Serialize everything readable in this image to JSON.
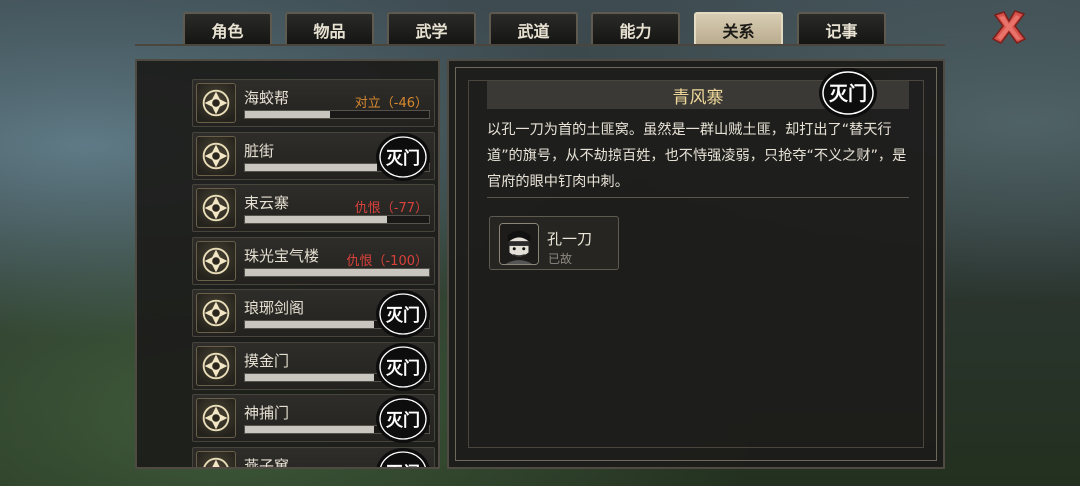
{
  "tabs": [
    {
      "label": "角色",
      "active": false
    },
    {
      "label": "物品",
      "active": false
    },
    {
      "label": "武学",
      "active": false
    },
    {
      "label": "武道",
      "active": false
    },
    {
      "label": "能力",
      "active": false
    },
    {
      "label": "关系",
      "active": true
    },
    {
      "label": "记事",
      "active": false
    }
  ],
  "close_icon": "close-x-icon",
  "stamp_text": "灭门",
  "factions": [
    {
      "name": "海蛟帮",
      "status": "对立（-46）",
      "status_color": "#d8892e",
      "relation": 0.46,
      "destroyed": false,
      "icon": "sea-dragon-emblem-icon"
    },
    {
      "name": "脏街",
      "status": "",
      "relation": 0.72,
      "destroyed": true,
      "icon": "beast-mask-emblem-icon"
    },
    {
      "name": "束云寨",
      "status": "仇恨（-77）",
      "status_color": "#d8413a",
      "relation": 0.77,
      "destroyed": false,
      "icon": "mountain-emblem-icon"
    },
    {
      "name": "珠光宝气楼",
      "status": "仇恨（-100）",
      "status_color": "#d8413a",
      "relation": 1.0,
      "destroyed": false,
      "icon": "treasure-emblem-icon"
    },
    {
      "name": "琅琊剑阁",
      "status": "",
      "relation": 0.7,
      "destroyed": true,
      "icon": "crown-emblem-icon"
    },
    {
      "name": "摸金门",
      "status": "",
      "relation": 0.7,
      "destroyed": true,
      "icon": "tomb-emblem-icon"
    },
    {
      "name": "神捕门",
      "status": "",
      "relation": 0.7,
      "destroyed": true,
      "icon": "eye-emblem-icon"
    },
    {
      "name": "燕子窠",
      "status": "",
      "relation": 0.7,
      "destroyed": true,
      "icon": "swallow-emblem-icon"
    }
  ],
  "detail": {
    "title": "青风寨",
    "destroyed": true,
    "description": "以孔一刀为首的土匪窝。虽然是一群山贼土匪，却打出了“替天行道”的旗号，从不劫掠百姓，也不恃强凌弱，只抢夺“不义之财”，是官府的眼中钉肉中刺。",
    "members": [
      {
        "name": "孔一刀",
        "status": "已故",
        "icon": "bandit-portrait-icon"
      }
    ]
  }
}
